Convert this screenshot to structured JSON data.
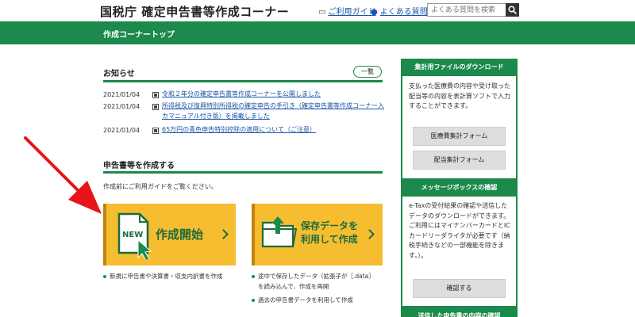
{
  "header": {
    "title": "国税庁 確定申告書等作成コーナー",
    "guide_label": "ご利用ガイド",
    "faq_label": "よくある質問",
    "search_placeholder": "よくある質問を検索"
  },
  "band": {
    "title": "作成コーナートップ"
  },
  "notices": {
    "title": "お知らせ",
    "list_button": "一覧",
    "items": [
      {
        "date": "2021/01/04",
        "text": "令和２年分の確定申告書等作成コーナーを公開しました"
      },
      {
        "date": "2021/01/04",
        "text_line1": "所得税及び復興特別所得税の確定申告の手引き（確定申告書等作成コーナー入",
        "text_line2": "カマニュアル付き版）を掲載しました"
      },
      {
        "date": "2021/01/04",
        "text": "65万円の青色申告特別控除の適用について（ご注意）"
      }
    ]
  },
  "create": {
    "title": "申告書等を作成する",
    "intro": "作成前にご利用ガイドをご覧ください。",
    "start_card": {
      "badge": "NEW",
      "label": "作成開始"
    },
    "load_card": {
      "label_line1": "保存データを",
      "label_line2": "利用して作成"
    },
    "start_bullets": [
      "新規に申告書や決算書・収支内訳書を作成"
    ],
    "load_bullets": [
      "途中で保存したデータ（拡張子が［.data］",
      "を読み込んで、作成を再開",
      "過去の申告書データを利用して作成"
    ]
  },
  "sidebar": {
    "download": {
      "title": "集計用ファイルのダウンロード",
      "text": "支払った医療費の内容や受け取った配当等の内容を表計算ソフトで入力することができます。",
      "button1": "医療費集計フォーム",
      "button2": "配当集計フォーム"
    },
    "messagebox": {
      "title": "メッセージボックスの確認",
      "text": "e-Taxの受付結果の確認や送信したデータのダウンロードができます。ご利用にはマイナンバーカードとICカードリーダライタが必要です（納税手続きなどの一部機能を除きます。）。",
      "button": "確認する"
    },
    "next_title": "送信した申告書の内容の確認"
  },
  "colors": {
    "green": "#1b8a4c",
    "card": "#f5bd2f",
    "link": "#1a55a8",
    "arrow": "#e8141c"
  }
}
